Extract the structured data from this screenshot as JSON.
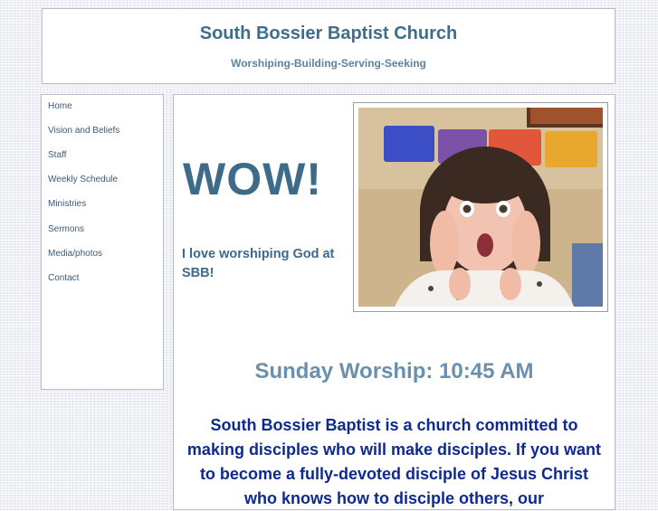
{
  "header": {
    "title": "South Bossier Baptist Church",
    "tagline": "Worshiping-Building-Serving-Seeking"
  },
  "nav": {
    "items": [
      {
        "label": "Home"
      },
      {
        "label": "Vision and Beliefs"
      },
      {
        "label": "Staff"
      },
      {
        "label": "Weekly Schedule"
      },
      {
        "label": "Ministries"
      },
      {
        "label": "Sermons"
      },
      {
        "label": "Media/photos"
      },
      {
        "label": "Contact"
      }
    ]
  },
  "main": {
    "headline": "WOW!",
    "caption": "I love worshiping God at SBB!",
    "worship_time": "Sunday Worship: 10:45 AM",
    "mission": "South Bossier Baptist is a church committed to making disciples who will make disciples.  If you want to become a fully-devoted disciple of Jesus Christ who knows how to disciple others, our"
  },
  "colors": {
    "title": "#3f6e8c",
    "tagline": "#5b84a2",
    "nav_link": "#3a5a78",
    "mission_text": "#0f2a8f"
  }
}
